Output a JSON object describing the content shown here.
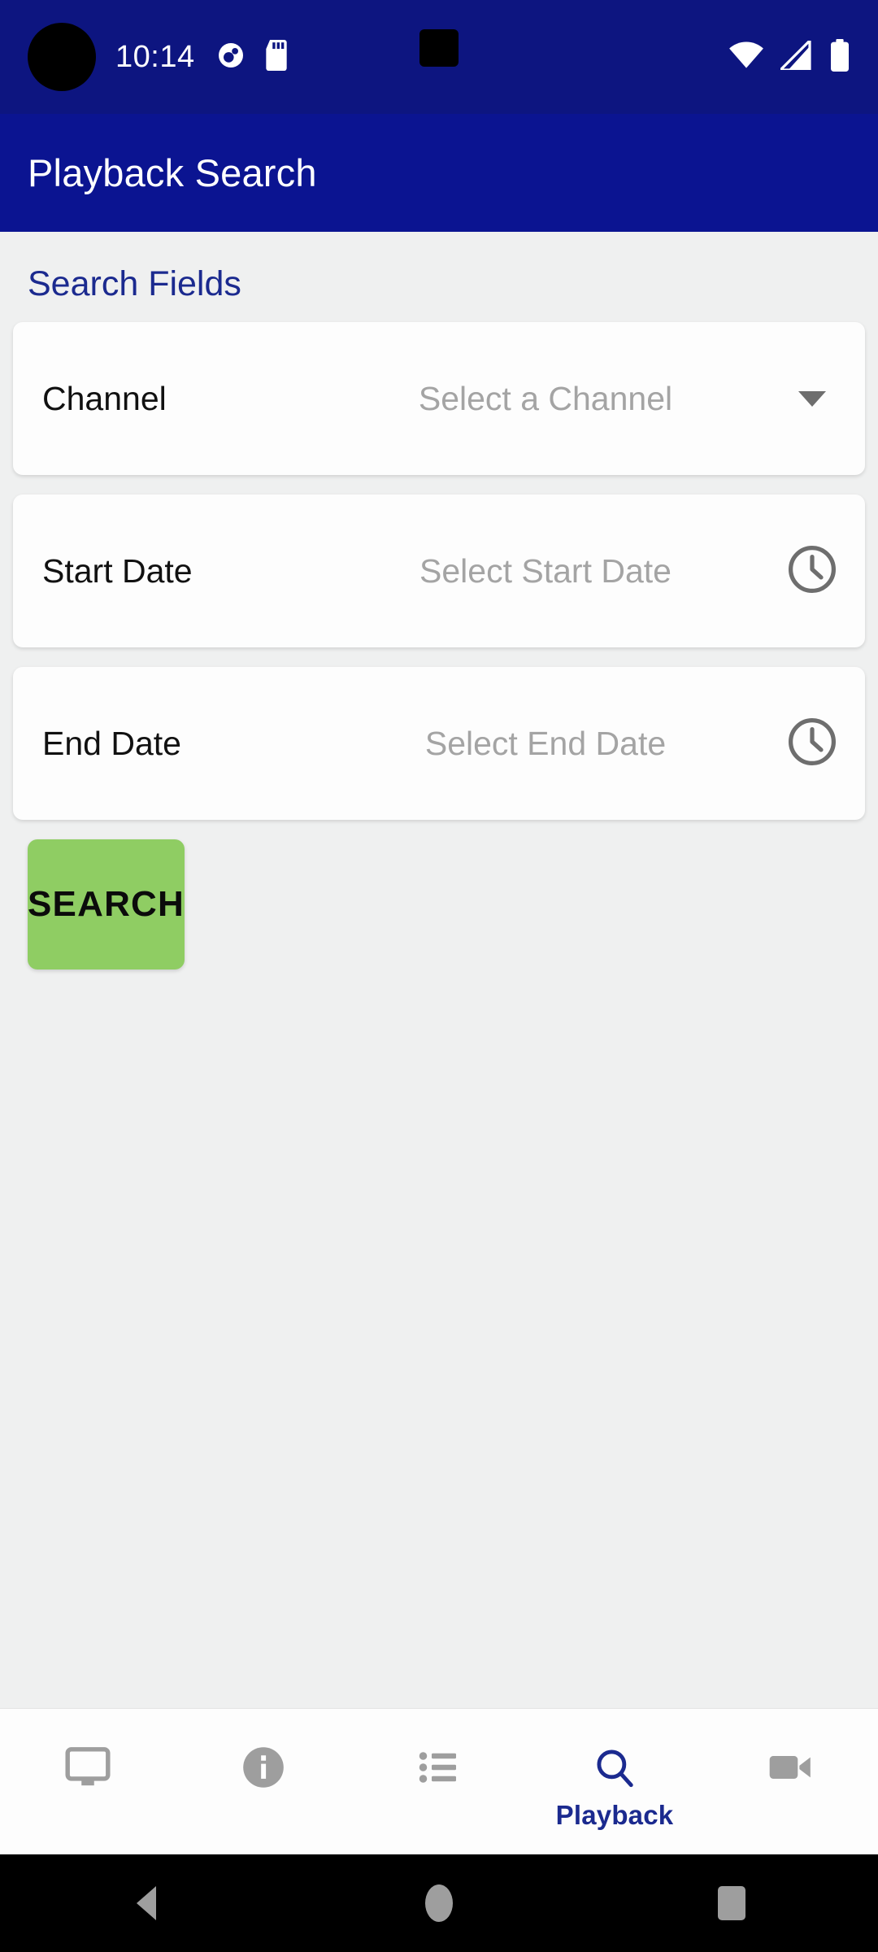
{
  "status_bar": {
    "clock": "10:14",
    "notification_icons": [
      "location-icon",
      "sd-card-icon"
    ],
    "system_icons": [
      "wifi-icon",
      "cellular-signal-icon",
      "battery-icon"
    ],
    "background_color": "#0d1580"
  },
  "app_bar": {
    "title": "Playback Search",
    "background_color": "#0b1491",
    "text_color": "#ffffff"
  },
  "content": {
    "background_color": "#eff0f0",
    "section_title": "Search Fields",
    "section_title_color": "#1b2a8f",
    "fields": [
      {
        "label": "Channel",
        "value": "",
        "placeholder": "Select a Channel",
        "trailing_icon": "chevron-down-icon",
        "name": "channel"
      },
      {
        "label": "Start Date",
        "value": "",
        "placeholder": "Select Start Date",
        "trailing_icon": "clock-icon",
        "name": "start-date"
      },
      {
        "label": "End Date",
        "value": "",
        "placeholder": "Select End Date",
        "trailing_icon": "clock-icon",
        "name": "end-date"
      }
    ],
    "search_button": {
      "label": "SEARCH",
      "background_color": "#8fcd63",
      "text_color": "#0b0b0b"
    }
  },
  "bottom_nav": {
    "active_color": "#1b2a8f",
    "inactive_color": "#9e9e9e",
    "items": [
      {
        "name": "live-view",
        "icon": "monitor-icon",
        "label": "",
        "active": false
      },
      {
        "name": "info",
        "icon": "info-circle-icon",
        "label": "",
        "active": false
      },
      {
        "name": "events",
        "icon": "list-icon",
        "label": "",
        "active": false
      },
      {
        "name": "playback",
        "icon": "search-icon",
        "label": "Playback",
        "active": true
      },
      {
        "name": "recording",
        "icon": "video-camera-icon",
        "label": "",
        "active": false
      }
    ]
  },
  "system_nav": {
    "background_color": "#000000",
    "buttons": [
      {
        "name": "back",
        "icon": "back-triangle-icon"
      },
      {
        "name": "home",
        "icon": "home-circle-icon"
      },
      {
        "name": "recents",
        "icon": "recents-square-icon"
      }
    ]
  }
}
